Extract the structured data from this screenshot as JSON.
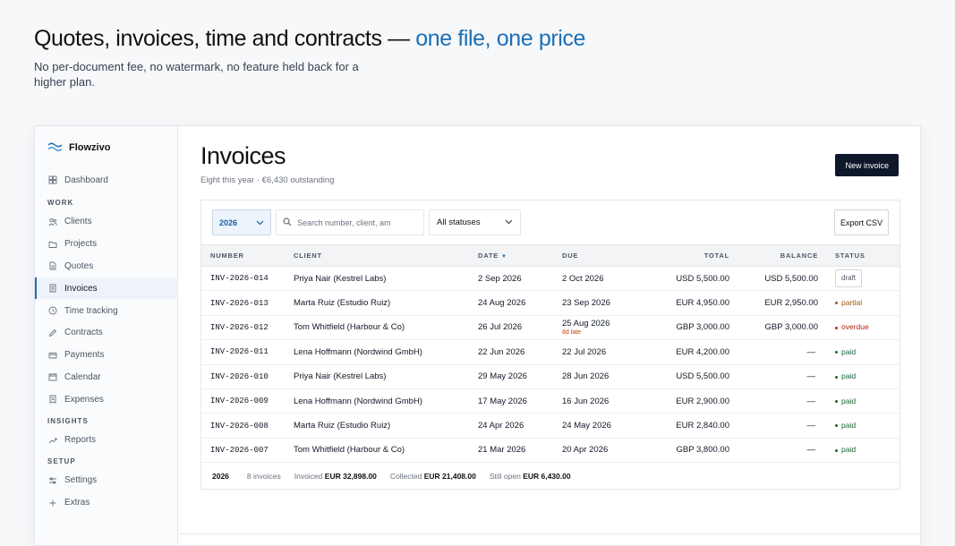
{
  "hero": {
    "title_main": "Quotes, invoices, time and contracts —",
    "title_accent": "one file, one price",
    "subtitle": "No per-document fee, no watermark, no feature held back for a higher plan."
  },
  "brand": {
    "name": "Flowzivo",
    "icon": "wave-logo-icon"
  },
  "sidebar": {
    "top_item": {
      "label": "Dashboard",
      "icon": "grid-icon"
    },
    "sections": [
      {
        "label": "WORK",
        "items": [
          {
            "label": "Clients",
            "icon": "users-icon"
          },
          {
            "label": "Projects",
            "icon": "folder-icon"
          },
          {
            "label": "Quotes",
            "icon": "document-icon"
          },
          {
            "label": "Invoices",
            "icon": "invoice-icon",
            "active": true
          },
          {
            "label": "Time tracking",
            "icon": "clock-icon"
          },
          {
            "label": "Contracts",
            "icon": "pen-icon"
          },
          {
            "label": "Payments",
            "icon": "card-icon"
          },
          {
            "label": "Calendar",
            "icon": "calendar-icon"
          },
          {
            "label": "Expenses",
            "icon": "receipt-icon"
          }
        ]
      },
      {
        "label": "INSIGHTS",
        "items": [
          {
            "label": "Reports",
            "icon": "trend-icon"
          }
        ]
      },
      {
        "label": "SETUP",
        "items": [
          {
            "label": "Settings",
            "icon": "sliders-icon"
          },
          {
            "label": "Extras",
            "icon": "plus-icon"
          }
        ]
      }
    ]
  },
  "page": {
    "title": "Invoices",
    "subtitle": "Eight this year · €6,430 outstanding",
    "new_button": "New invoice"
  },
  "toolbar": {
    "year": "2026",
    "search_placeholder": "Search number, client, amount",
    "status_filter": "All statuses",
    "export_button": "Export CSV"
  },
  "table": {
    "headers": {
      "number": "NUMBER",
      "client": "CLIENT",
      "date": "DATE",
      "due": "DUE",
      "total": "TOTAL",
      "balance": "BALANCE",
      "status": "STATUS"
    },
    "sort_indicator": "▼",
    "rows": [
      {
        "number": "INV-2026-014",
        "client": "Priya Nair (Kestrel Labs)",
        "date": "2 Sep 2026",
        "due": "2 Oct 2026",
        "due_note": "",
        "total": "USD 5,500.00",
        "balance": "USD 5,500.00",
        "status": "draft"
      },
      {
        "number": "INV-2026-013",
        "client": "Marta Ruiz (Estudio Ruiz)",
        "date": "24 Aug 2026",
        "due": "23 Sep 2026",
        "due_note": "",
        "total": "EUR 4,950.00",
        "balance": "EUR 2,950.00",
        "status": "partial"
      },
      {
        "number": "INV-2026-012",
        "client": "Tom Whitfield (Harbour & Co)",
        "date": "26 Jul 2026",
        "due": "25 Aug 2026",
        "due_note": "8d late",
        "total": "GBP 3,000.00",
        "balance": "GBP 3,000.00",
        "status": "overdue"
      },
      {
        "number": "INV-2026-011",
        "client": "Lena Hoffmann (Nordwind GmbH)",
        "date": "22 Jun 2026",
        "due": "22 Jul 2026",
        "due_note": "",
        "total": "EUR 4,200.00",
        "balance": "—",
        "status": "paid"
      },
      {
        "number": "INV-2026-010",
        "client": "Priya Nair (Kestrel Labs)",
        "date": "29 May 2026",
        "due": "28 Jun 2026",
        "due_note": "",
        "total": "USD 5,500.00",
        "balance": "—",
        "status": "paid"
      },
      {
        "number": "INV-2026-009",
        "client": "Lena Hoffmann (Nordwind GmbH)",
        "date": "17 May 2026",
        "due": "16 Jun 2026",
        "due_note": "",
        "total": "EUR 2,900.00",
        "balance": "—",
        "status": "paid"
      },
      {
        "number": "INV-2026-008",
        "client": "Marta Ruiz (Estudio Ruiz)",
        "date": "24 Apr 2026",
        "due": "24 May 2026",
        "due_note": "",
        "total": "EUR 2,840.00",
        "balance": "—",
        "status": "paid"
      },
      {
        "number": "INV-2026-007",
        "client": "Tom Whitfield (Harbour & Co)",
        "date": "21 Mar 2026",
        "due": "20 Apr 2026",
        "due_note": "",
        "total": "GBP 3,800.00",
        "balance": "—",
        "status": "paid"
      }
    ]
  },
  "footer": {
    "year": "2026",
    "count": "8 invoices",
    "invoiced_label": "Invoiced",
    "invoiced_value": "EUR 32,898.00",
    "collected_label": "Collected",
    "collected_value": "EUR 21,408.00",
    "open_label": "Still open",
    "open_value": "EUR 6,430.00"
  },
  "colors": {
    "accent": "#1c6fb5",
    "paid": "#166534",
    "partial": "#9a5b0e",
    "overdue": "#b42318",
    "button_dark": "#0f172a"
  }
}
